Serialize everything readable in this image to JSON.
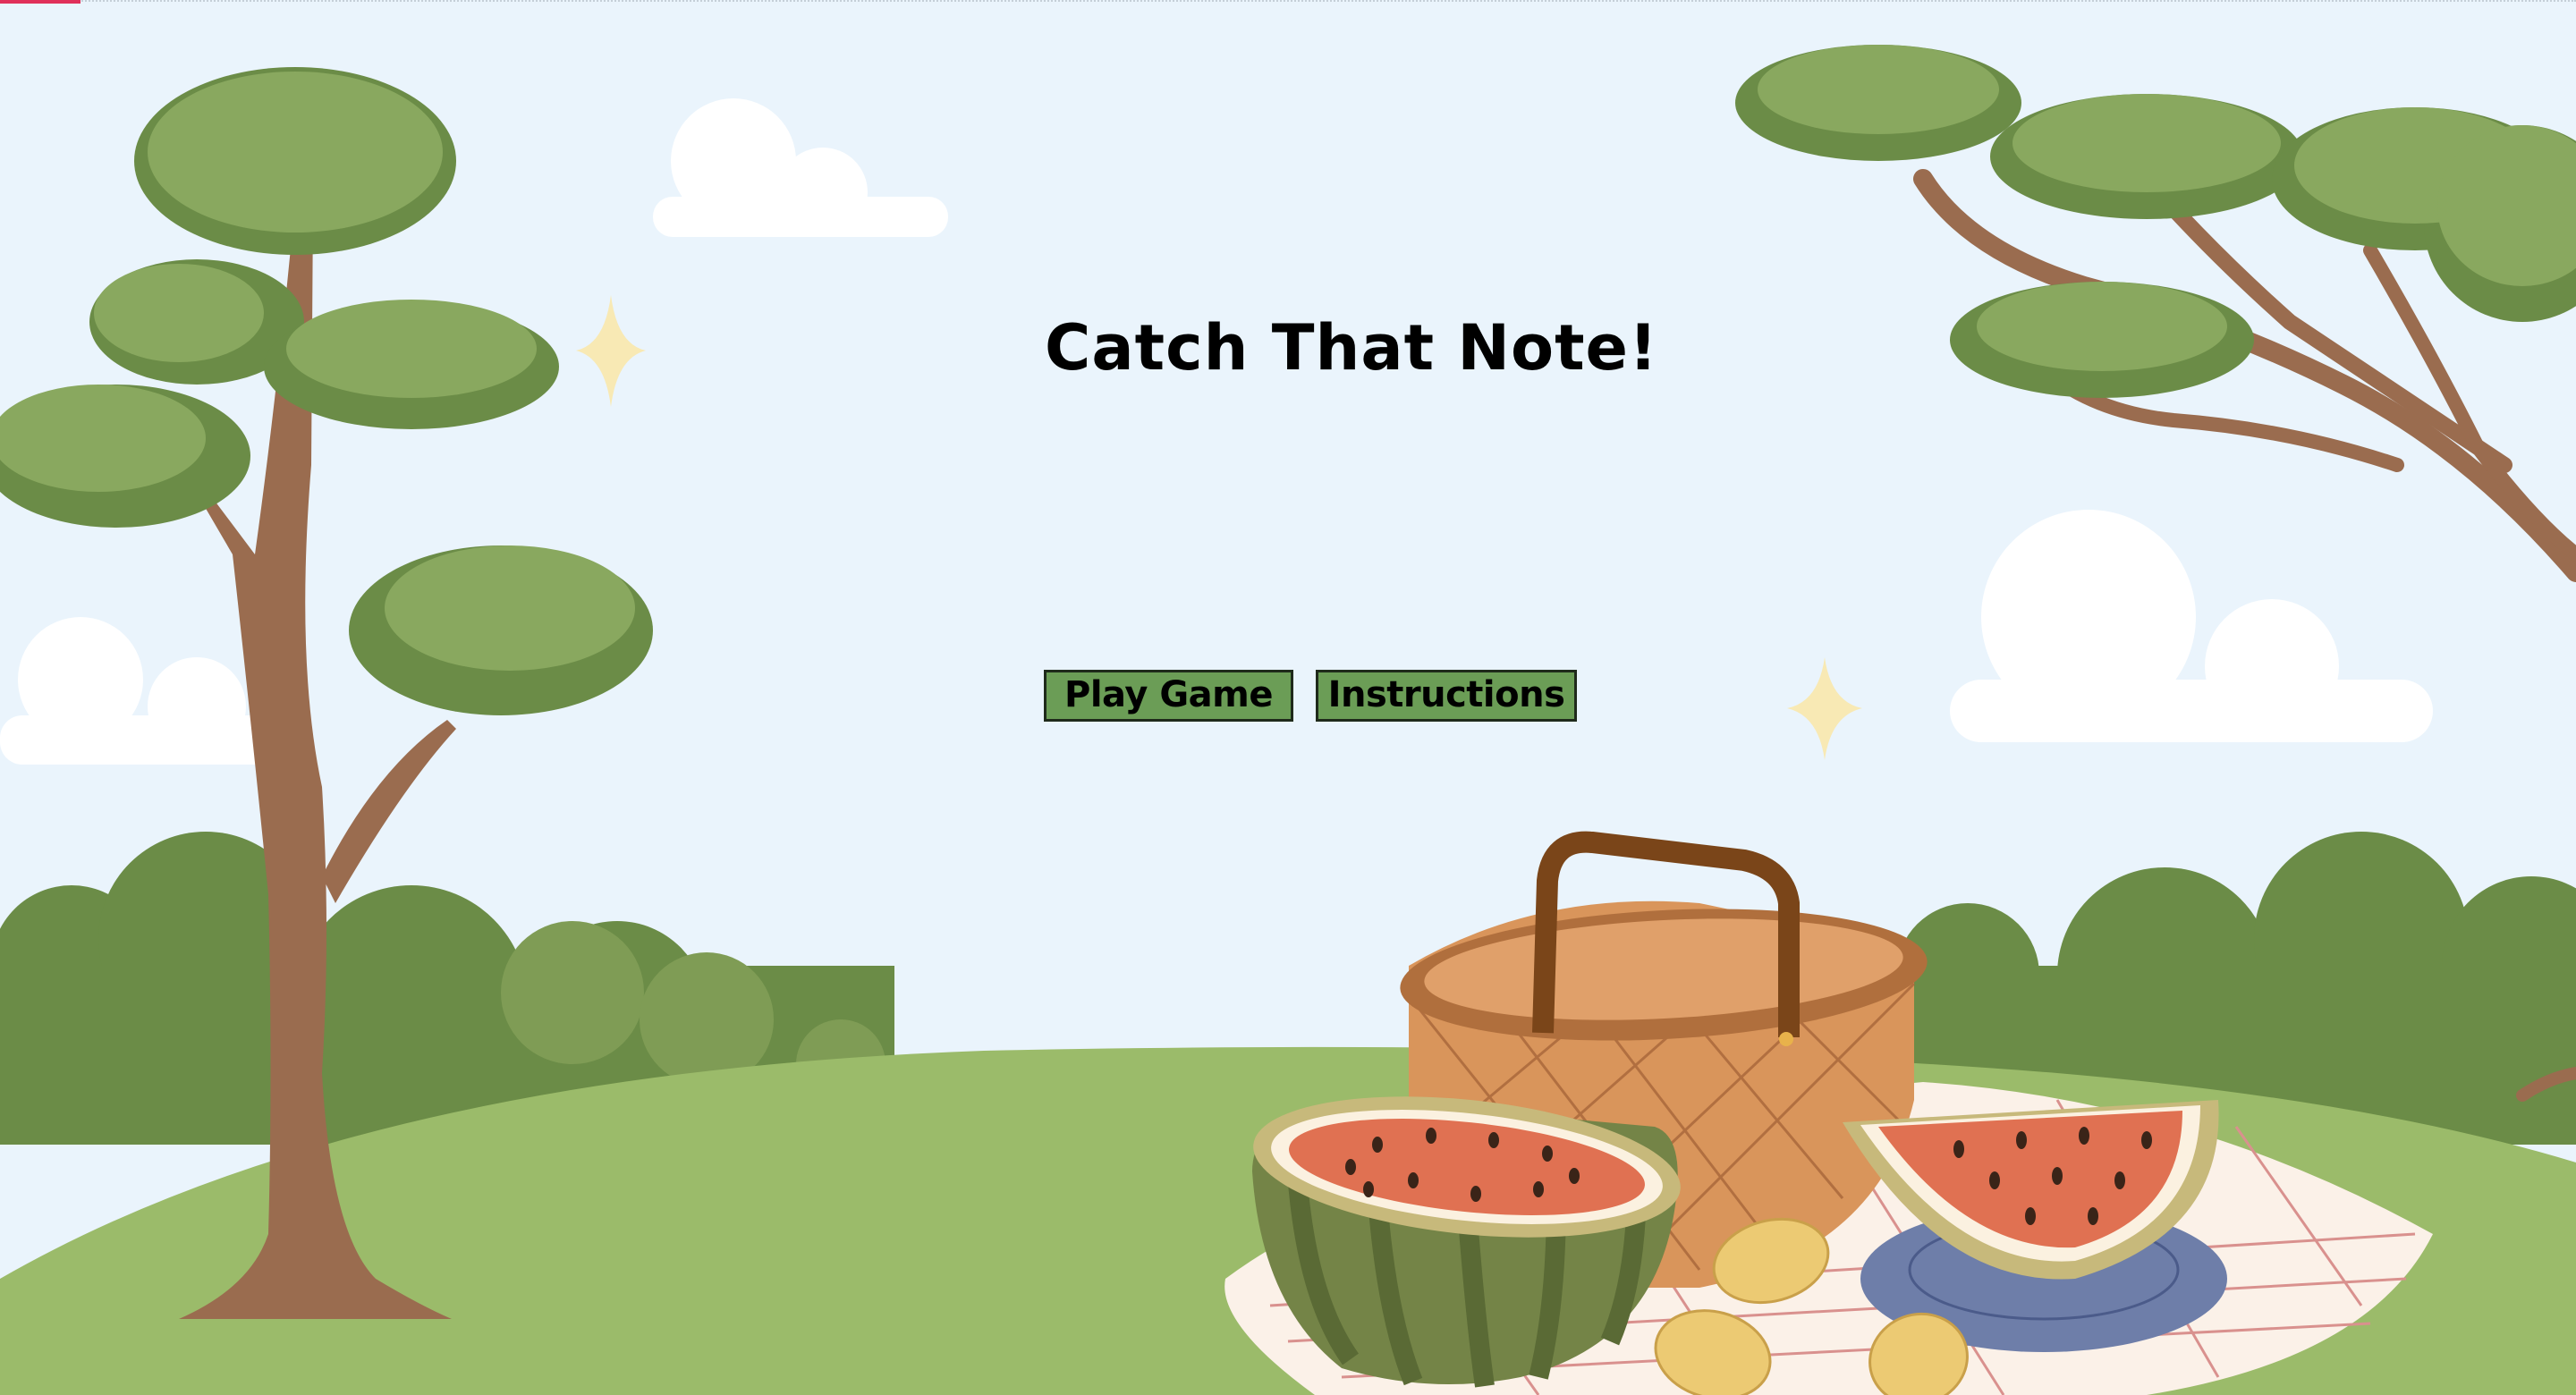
{
  "game": {
    "title": "Catch That Note!"
  },
  "menu": {
    "play_label": "Play Game",
    "instructions_label": "Instructions"
  },
  "theme": {
    "sky": "#eaf4fc",
    "button_fill": "#6b9d56",
    "grass_light": "#9bbb6a",
    "bush_dark": "#6b8c47",
    "tree_trunk": "#9a6c4f",
    "watermelon_flesh": "#e07152",
    "basket": "#d9955b",
    "top_progress": "#e0305a"
  }
}
